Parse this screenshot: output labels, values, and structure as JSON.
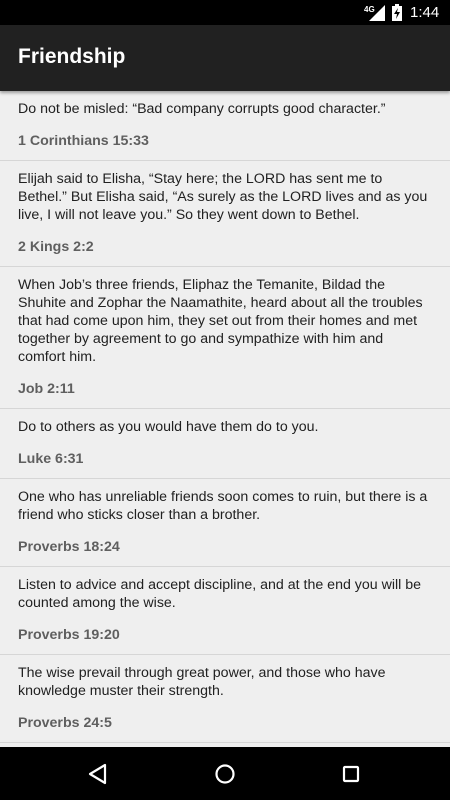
{
  "status_bar": {
    "network": "4G",
    "time": "1:44"
  },
  "app_bar": {
    "title": "Friendship"
  },
  "verses": [
    {
      "text": "Do not be misled: “Bad company corrupts good character.”",
      "reference": "1 Corinthians 15:33"
    },
    {
      "text": "Elijah said to Elisha, “Stay here; the LORD has sent me to Bethel.” But Elisha said, “As surely as the LORD lives and as you live, I will not leave you.” So they went down to Bethel.",
      "reference": "2 Kings 2:2"
    },
    {
      "text": "When Job’s three friends, Eliphaz the Temanite, Bildad the Shuhite and Zophar the Naamathite, heard about all the troubles that had come upon him, they set out from their homes and met together by agreement to go and sympathize with him and comfort him.",
      "reference": "Job 2:11"
    },
    {
      "text": "Do to others as you would have them do to you.",
      "reference": "Luke 6:31"
    },
    {
      "text": "One who has unreliable friends soon comes to ruin, but there is a friend who sticks closer than a brother.",
      "reference": "Proverbs 18:24"
    },
    {
      "text": "Listen to advice and accept discipline, and at the end you will be counted among the wise.",
      "reference": "Proverbs 19:20"
    },
    {
      "text": "The wise prevail through great power, and those who have knowledge muster their strength.",
      "reference": "Proverbs 24:5"
    }
  ],
  "nav_bar": {
    "back_icon": "back-triangle",
    "home_icon": "home-circle",
    "recents_icon": "recents-square"
  },
  "colors": {
    "app_bar": "#212121",
    "background": "#efefef",
    "text": "#212121",
    "reference": "#5f5f5f",
    "divider": "#d6d6d6"
  }
}
